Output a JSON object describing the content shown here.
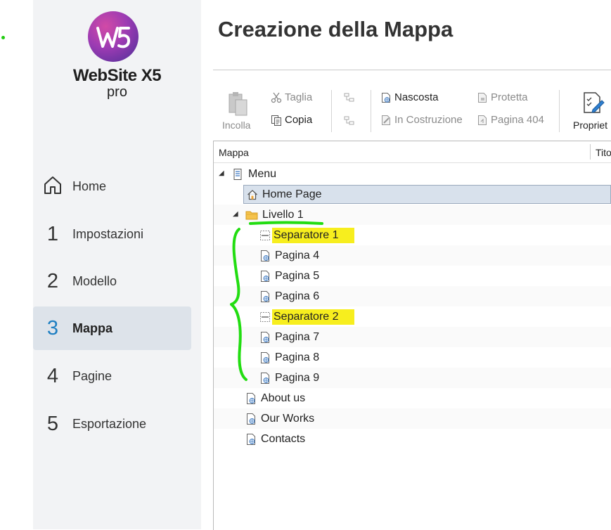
{
  "app": {
    "logo_name": "WebSite X5",
    "logo_sub": "pro",
    "logo_mark": "W5"
  },
  "sidebar": {
    "items": [
      {
        "num": "",
        "label": "Home",
        "icon": "home-icon"
      },
      {
        "num": "1",
        "label": "Impostazioni"
      },
      {
        "num": "2",
        "label": "Modello"
      },
      {
        "num": "3",
        "label": "Mappa",
        "active": true
      },
      {
        "num": "4",
        "label": "Pagine"
      },
      {
        "num": "5",
        "label": "Esportazione"
      }
    ]
  },
  "main": {
    "title": "Creazione della Mappa"
  },
  "toolbar": {
    "paste": "Incolla",
    "cut": "Taglia",
    "copy": "Copia",
    "hidden": "Nascosta",
    "under_construction": "In Costruzione",
    "protected": "Protetta",
    "page404": "Pagina 404",
    "properties": "Propriet"
  },
  "tree": {
    "col_map": "Mappa",
    "col_title": "Tito",
    "rows": [
      {
        "label": "Menu",
        "icon": "menu-icon"
      },
      {
        "label": "Home Page",
        "icon": "house-icon"
      },
      {
        "label": "Livello 1",
        "icon": "folder-icon"
      },
      {
        "label": "Separatore 1",
        "icon": "separator-icon"
      },
      {
        "label": "Pagina 4",
        "icon": "page-icon"
      },
      {
        "label": "Pagina 5",
        "icon": "page-icon"
      },
      {
        "label": "Pagina 6",
        "icon": "page-icon"
      },
      {
        "label": "Separatore 2",
        "icon": "separator-icon"
      },
      {
        "label": "Pagina 7",
        "icon": "page-icon"
      },
      {
        "label": "Pagina 8",
        "icon": "page-icon"
      },
      {
        "label": "Pagina 9",
        "icon": "page-icon"
      },
      {
        "label": "About us",
        "icon": "page-icon"
      },
      {
        "label": "Our Works",
        "icon": "page-icon"
      },
      {
        "label": "Contacts",
        "icon": "page-icon"
      }
    ]
  },
  "colors": {
    "accent": "#1e7fc2",
    "highlight": "#f7ee1e",
    "annotation": "#22dd11",
    "selected_row": "#d8e1ec"
  }
}
